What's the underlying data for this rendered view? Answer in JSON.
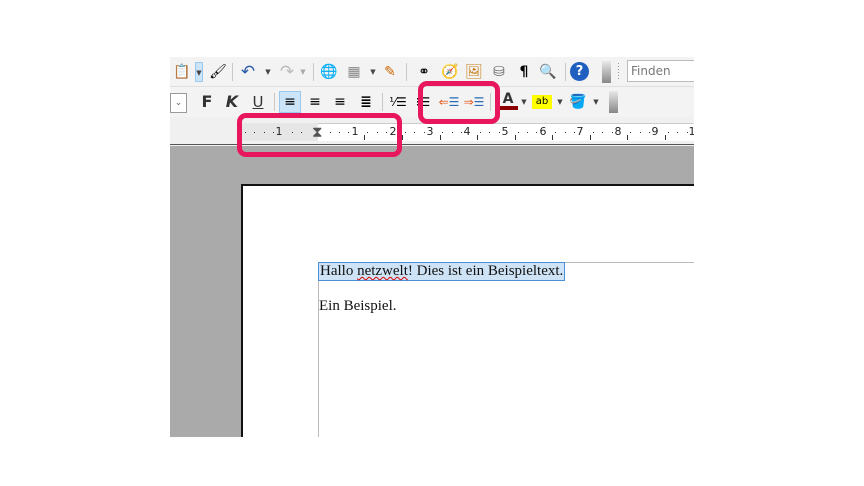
{
  "toolbar_standard": {
    "items": [
      {
        "name": "paste",
        "icon": "paste-icon"
      },
      {
        "name": "paste-dropdown",
        "icon": "chevron-down-icon"
      },
      {
        "name": "clone-formatting",
        "icon": "brush-icon"
      },
      {
        "name": "undo",
        "icon": "undo-icon"
      },
      {
        "name": "undo-dropdown",
        "icon": "chevron-down-icon"
      },
      {
        "name": "redo",
        "icon": "redo-icon"
      },
      {
        "name": "redo-dropdown",
        "icon": "chevron-down-icon"
      },
      {
        "name": "hyperlink",
        "icon": "globe-link-icon"
      },
      {
        "name": "table",
        "icon": "table-icon"
      },
      {
        "name": "draw",
        "icon": "pencil-icon"
      },
      {
        "name": "find-replace",
        "icon": "binoculars-icon"
      },
      {
        "name": "navigator",
        "icon": "compass-icon"
      },
      {
        "name": "gallery",
        "icon": "picture-icon"
      },
      {
        "name": "data-sources",
        "icon": "database-icon"
      },
      {
        "name": "formatting-marks",
        "icon": "pilcrow-icon"
      },
      {
        "name": "zoom",
        "icon": "magnifier-icon"
      },
      {
        "name": "help",
        "icon": "help-icon"
      }
    ],
    "find_placeholder": "Finden"
  },
  "toolbar_formatting": {
    "bold": "F",
    "italic": "K",
    "underline": "U",
    "align_left_active": true,
    "font_color": "#8b0000",
    "highlight_color": "#ffff00"
  },
  "ruler": {
    "labels": [
      "1",
      "1",
      "2",
      "3",
      "4",
      "5",
      "6",
      "7",
      "8",
      "9",
      "1"
    ]
  },
  "document": {
    "line1_pre": "Hallo ",
    "line1_misspelled": "netzwelt",
    "line1_post": "! Dies ist ein Beispieltext.",
    "line2": "Ein Beispiel."
  },
  "callout_color": "#e8175d"
}
